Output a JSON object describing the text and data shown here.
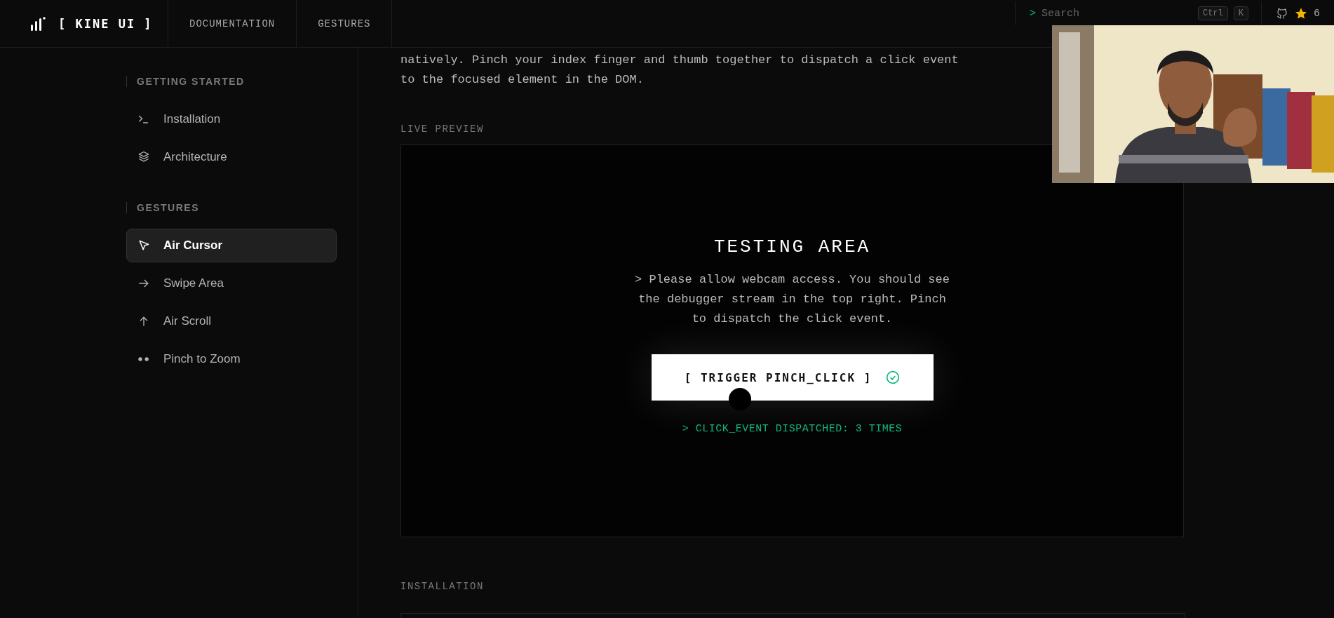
{
  "header": {
    "logo": "[ KINE UI ]",
    "nav": [
      {
        "label": "DOCUMENTATION"
      },
      {
        "label": "GESTURES"
      }
    ],
    "search": {
      "prompt": ">",
      "placeholder": "Search"
    },
    "shortcut": [
      "Ctrl",
      "K"
    ],
    "stars": "6"
  },
  "sidebar": {
    "sections": [
      {
        "title": "GETTING STARTED",
        "items": [
          {
            "label": "Installation",
            "selected": false
          },
          {
            "label": "Architecture",
            "selected": false
          }
        ]
      },
      {
        "title": "GESTURES",
        "items": [
          {
            "label": "Air Cursor",
            "selected": true
          },
          {
            "label": "Swipe Area",
            "selected": false
          },
          {
            "label": "Air Scroll",
            "selected": false
          },
          {
            "label": "Pinch to Zoom",
            "selected": false
          }
        ]
      }
    ]
  },
  "content": {
    "intro": "natively. Pinch your index finger and thumb together to dispatch a click event to the focused element in the DOM.",
    "preview": {
      "label": "LIVE PREVIEW",
      "title": "TESTING AREA",
      "message": "> Please allow webcam access. You should see the debugger stream in the top right. Pinch to dispatch the click event.",
      "button": {
        "label": "[ TRIGGER PINCH_CLICK ]",
        "success": true
      },
      "status": "> CLICK_EVENT DISPATCHED: 3 TIMES"
    },
    "next_section": "INSTALLATION"
  }
}
